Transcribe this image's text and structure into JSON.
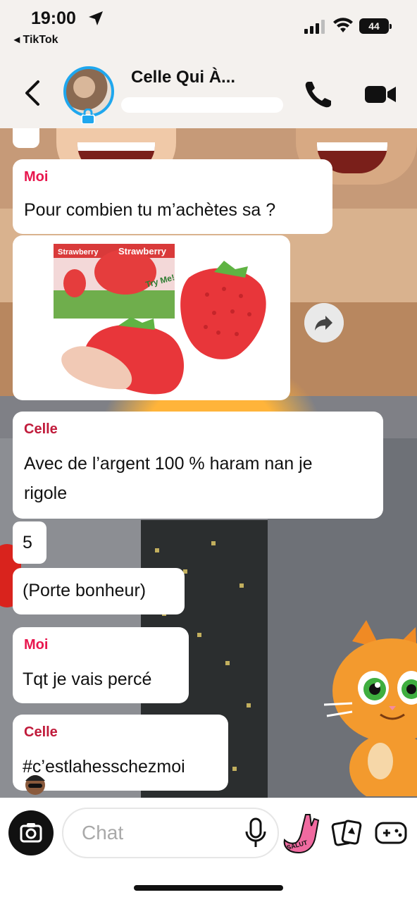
{
  "status_bar": {
    "time": "19:00",
    "back_app": "◂ TikTok",
    "battery": "44"
  },
  "header": {
    "contact_name": "Celle Qui À..."
  },
  "messages": [
    {
      "sender": "Moi",
      "text": "Pour combien tu m’achètes sa ?"
    },
    {
      "sender": "Celle",
      "lines": [
        "Avec de l’argent 100 % haram nan je",
        "rigole"
      ]
    },
    {
      "text": "5"
    },
    {
      "text": "(Porte bonheur)"
    },
    {
      "sender": "Moi",
      "text": "Tqt je vais percé"
    },
    {
      "sender": "Celle",
      "text": "#c’estlahesschezmoi"
    }
  ],
  "image_card": {
    "box_text_1": "Strawberry",
    "box_text_2": "Strawberry",
    "box_text_3": "Try Me!"
  },
  "bottom_bar": {
    "chat_placeholder": "Chat",
    "sticker_text": "SALUT"
  },
  "colors": {
    "sender_me": "#e8174e",
    "sender_them": "#c01a3a",
    "avatar_ring": "#1fa7ee"
  }
}
